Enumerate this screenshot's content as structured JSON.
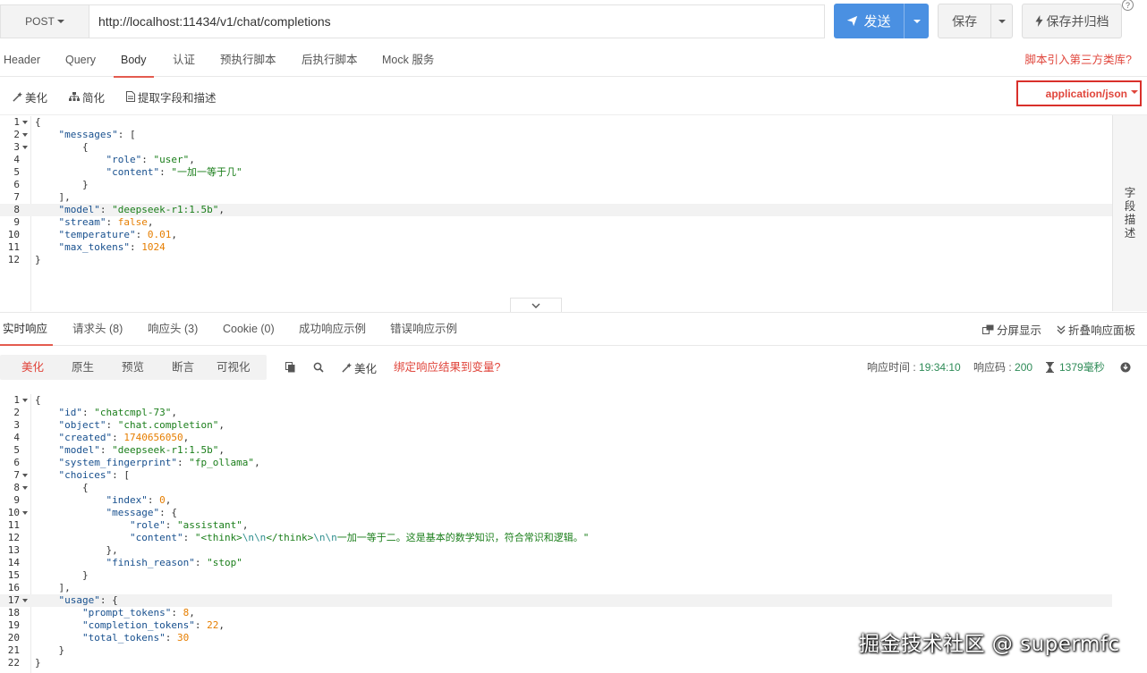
{
  "request": {
    "method": "POST",
    "url": "http://localhost:11434/v1/chat/completions",
    "send_label": "发送",
    "save_label": "保存",
    "save_all_label": "保存并归档",
    "help": "?"
  },
  "request_tabs": [
    {
      "label": "Header"
    },
    {
      "label": "Query"
    },
    {
      "label": "Body"
    },
    {
      "label": "认证"
    },
    {
      "label": "预执行脚本"
    },
    {
      "label": "后执行脚本"
    },
    {
      "label": "Mock 服务"
    }
  ],
  "library_link": "脚本引入第三方类库?",
  "body_toolbar": {
    "beautify": "美化",
    "simplify": "简化",
    "extract": "提取字段和描述",
    "content_type": "application/json"
  },
  "side_panel_label": "字段描述",
  "request_body_lines": [
    "{",
    "    \"messages\": [",
    "        {",
    "            \"role\": \"user\",",
    "            \"content\": \"一加一等于几\"",
    "        }",
    "    ],",
    "    \"model\": \"deepseek-r1:1.5b\",",
    "    \"stream\": false,",
    "    \"temperature\": 0.01,",
    "    \"max_tokens\": 1024",
    "}"
  ],
  "response_tabs": [
    {
      "label": "实时响应"
    },
    {
      "label": "请求头 (8)"
    },
    {
      "label": "响应头 (3)"
    },
    {
      "label": "Cookie (0)"
    },
    {
      "label": "成功响应示例"
    },
    {
      "label": "错误响应示例"
    }
  ],
  "response_right_tools": {
    "split_view": "分屏显示",
    "collapse_panel": "折叠响应面板"
  },
  "view_modes": [
    {
      "label": "美化"
    },
    {
      "label": "原生"
    },
    {
      "label": "预览"
    },
    {
      "label": "断言"
    },
    {
      "label": "可视化"
    }
  ],
  "response_toolbar": {
    "beautify": "美化",
    "bind_link": "绑定响应结果到变量?"
  },
  "response_meta": {
    "time_label": "响应时间 :",
    "time_value": "19:34:10",
    "code_label": "响应码 :",
    "code_value": "200",
    "duration": "1379毫秒"
  },
  "response_body_lines": [
    "{",
    "    \"id\": \"chatcmpl-73\",",
    "    \"object\": \"chat.completion\",",
    "    \"created\": 1740656050,",
    "    \"model\": \"deepseek-r1:1.5b\",",
    "    \"system_fingerprint\": \"fp_ollama\",",
    "    \"choices\": [",
    "        {",
    "            \"index\": 0,",
    "            \"message\": {",
    "                \"role\": \"assistant\",",
    "                \"content\": \"<think>\\n\\n</think>\\n\\n一加一等于二。这是基本的数学知识，符合常识和逻辑。\"",
    "            },",
    "            \"finish_reason\": \"stop\"",
    "        }",
    "    ],",
    "    \"usage\": {",
    "        \"prompt_tokens\": 8,",
    "        \"completion_tokens\": 22,",
    "        \"total_tokens\": 30",
    "    }",
    "}"
  ],
  "watermark": "掘金技术社区 @ supermfc"
}
